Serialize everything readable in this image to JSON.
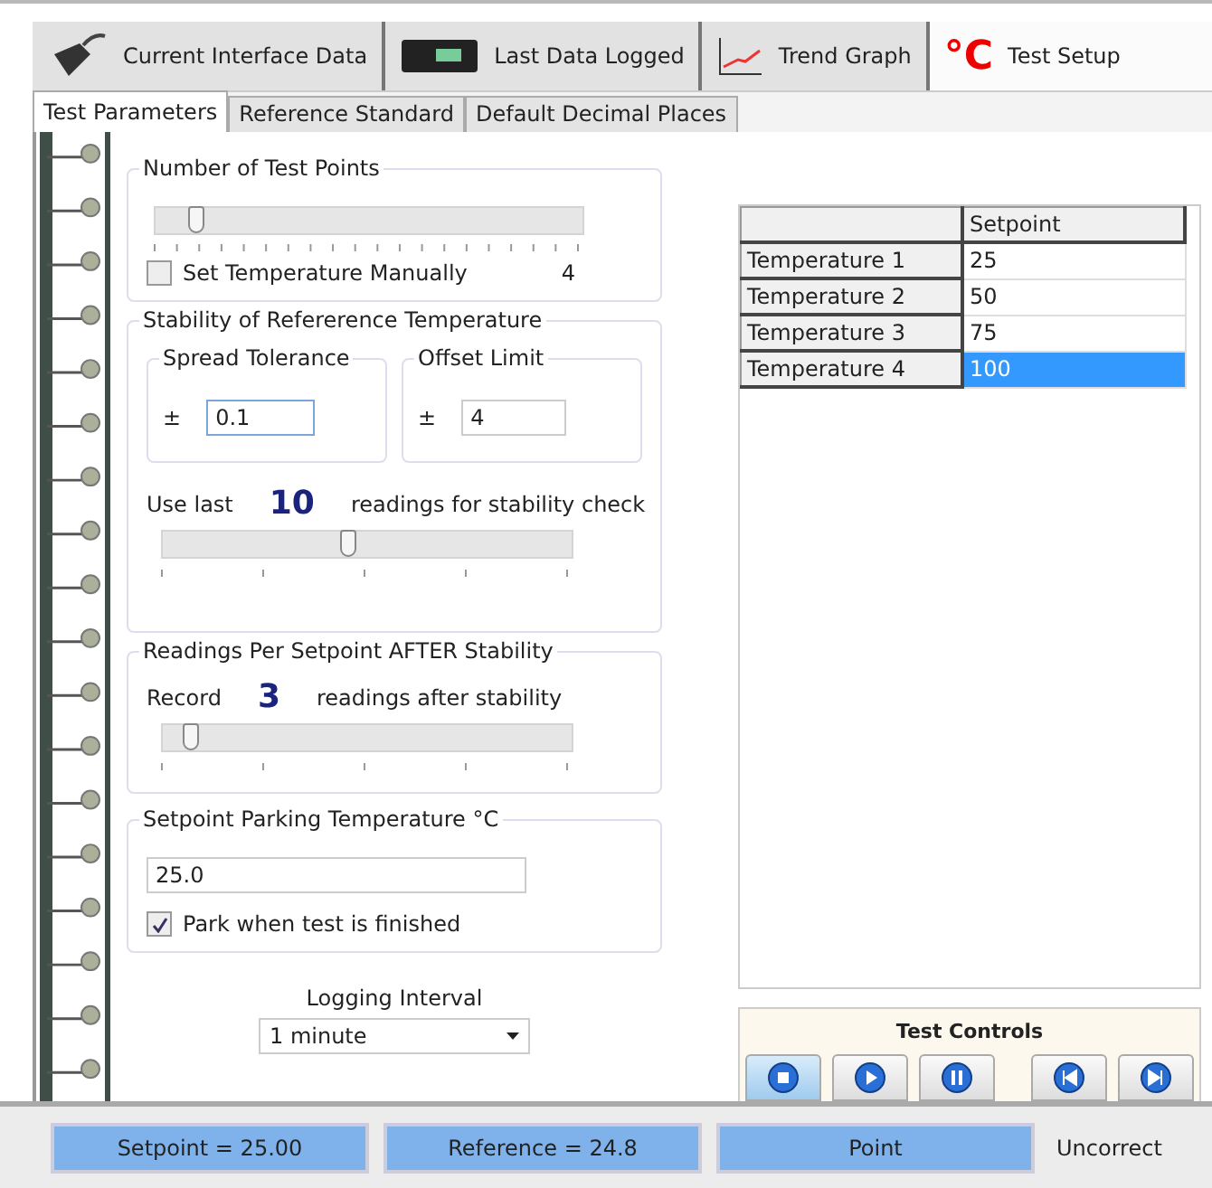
{
  "toolbar": [
    {
      "kind": "cable",
      "label": "Current Interface Data",
      "selected": false
    },
    {
      "kind": "logger",
      "label": "Last Data Logged",
      "selected": false
    },
    {
      "kind": "graph",
      "label": "Trend Graph",
      "selected": false
    },
    {
      "kind": "celsius",
      "glyph": "°C",
      "label": "Test Setup",
      "selected": true
    }
  ],
  "tabs": [
    {
      "label": "Test Parameters",
      "selected": true
    },
    {
      "label": "Reference Standard",
      "selected": false
    },
    {
      "label": "Default Decimal Places",
      "selected": false
    }
  ],
  "test_points": {
    "title": "Number of Test Points",
    "level": 0.08,
    "manual": {
      "label": "Set Temperature Manually",
      "checked": false
    },
    "count": "4"
  },
  "stability": {
    "title": "Stability of Refererence Temperature",
    "spread": {
      "title": "Spread Tolerance",
      "sign": "±",
      "value": "0.1"
    },
    "offset": {
      "title": "Offset Limit",
      "sign": "±",
      "value": "4"
    },
    "prefix": "Use last",
    "readings": "10",
    "suffix": "readings for stability check",
    "level": 0.45
  },
  "after": {
    "title": "Readings Per Setpoint AFTER Stability",
    "prefix": "Record",
    "readings": "3",
    "suffix": "readings after stability",
    "level": 0.05
  },
  "parking": {
    "title": "Setpoint Parking Temperature °C",
    "value": "25.0",
    "park": {
      "label": "Park when test is finished",
      "checked": true
    }
  },
  "logging": {
    "label": "Logging Interval",
    "value": "1 minute"
  },
  "table": {
    "columns": [
      "Setpoint"
    ],
    "rows": [
      {
        "label": "Temperature 1",
        "value": "25",
        "selected": false
      },
      {
        "label": "Temperature 2",
        "value": "50",
        "selected": false
      },
      {
        "label": "Temperature 3",
        "value": "75",
        "selected": false
      },
      {
        "label": "Temperature 4",
        "value": "100",
        "selected": true
      }
    ]
  },
  "test_controls": {
    "title": "Test Controls",
    "buttons": [
      {
        "kind": "stop",
        "selected": true
      },
      {
        "kind": "play",
        "selected": false
      },
      {
        "kind": "pause",
        "selected": false
      },
      {
        "kind": "back",
        "selected": false
      },
      {
        "kind": "forward",
        "selected": false
      }
    ]
  },
  "status_bar": [
    "Setpoint = 25.00",
    "Reference = 24.8",
    "Point"
  ],
  "status_text": "Uncorrect"
}
